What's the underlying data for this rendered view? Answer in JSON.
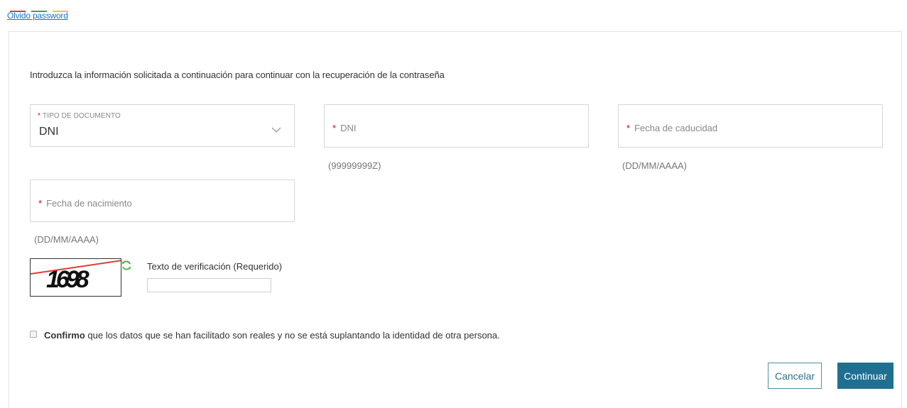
{
  "header": {
    "forgot_link": "Olvido password"
  },
  "form": {
    "intro": "Introduzca la información solicitada a continuación para continuar con la recuperación de la contraseña",
    "required_marker": "*",
    "doc_type": {
      "label": "TIPO DE DOCUMENTO",
      "value": "DNI"
    },
    "dni": {
      "placeholder": "DNI",
      "hint": "(99999999Z)"
    },
    "expiry": {
      "placeholder": "Fecha de caducidad",
      "hint": "(DD/MM/AAAA)"
    },
    "birth": {
      "placeholder": "Fecha de nacimiento",
      "hint": "(DD/MM/AAAA)"
    },
    "captcha": {
      "text": "1698",
      "label": "Texto de verificación (Requerido)",
      "value": ""
    },
    "confirm": {
      "bold": "Confirmo",
      "text": " que los datos que se han facilitado son reales y no se está suplantando la identidad de otra persona.",
      "checked": false
    },
    "buttons": {
      "cancel": "Cancelar",
      "continue": "Continuar"
    }
  },
  "colors": {
    "primary": "#1f6f91",
    "link": "#1a73c8",
    "required": "#d0021b",
    "refresh_icon": "#4caf50"
  },
  "icons": [
    "chevron-down-icon",
    "refresh-icon",
    "checkbox"
  ]
}
